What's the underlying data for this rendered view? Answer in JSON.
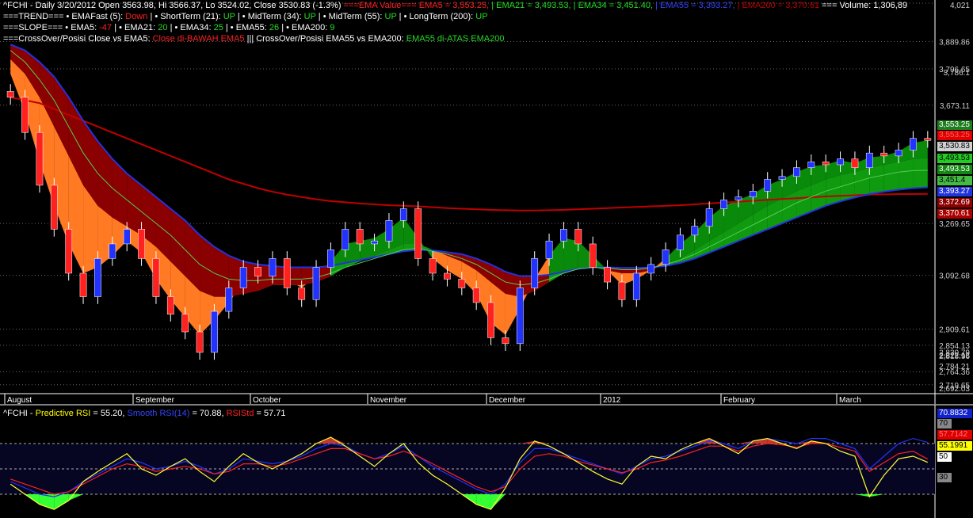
{
  "header": {
    "ticker_line": "^FCHI - Daily 3/20/2012 Open 3563.98, Hi 3566.37, Lo 3524.02, Close 3530.83 (-1.3%)",
    "ema_value_label": "===EMA Value=== EMA5 = 3,553.25,",
    "ema21": "| EMA21 = 3,493.53,",
    "ema34": "| EMA34 = 3,451.40,",
    "ema55": "| EMA55 = 3,393.27,",
    "ema200": "| EMA200 = 3,370.61",
    "volume": "=== Volume: 1,306,89",
    "trend_label": "===TREND=== • EMAFast (5):",
    "trend_fast": "Down",
    "trend_short_label": "| • ShortTerm (21):",
    "trend_short": "UP",
    "trend_mid_label": "| • MidTerm (34):",
    "trend_mid": "UP",
    "trend_mid55_label": "| • MidTerm (55):",
    "trend_mid55": "UP",
    "trend_long_label": "| • LongTerm (200):",
    "trend_long": "UP",
    "slope_label": "===SLOPE=== • EMA5:",
    "slope_ema5": "-47",
    "slope_ema21_label": "| • EMA21:",
    "slope_ema21": "20",
    "slope_ema34_label": "| • EMA34:",
    "slope_ema34": "25",
    "slope_ema55_label": "| • EMA55:",
    "slope_ema55": "26",
    "slope_ema200_label": "| • EMA200:",
    "slope_ema200": "9",
    "cross_label": "===CrossOver/Posisi Close vs EMA5:",
    "cross_value": "Close di-BAWAH EMA5",
    "cross2_label": "||| CrossOver/Posisi EMA55 vs EMA200:",
    "cross2_value": "EMA55 di-ATAS EMA200"
  },
  "rsi_header": {
    "ticker": "^FCHI -",
    "predictive_label": "Predictive RSI",
    "predictive_value": "= 55.20,",
    "smooth_label": "Smooth RSI(14)",
    "smooth_value": "= 70.88,",
    "rsistd_label": "RSIStd",
    "rsistd_value": "= 57.71"
  },
  "price_axis": [
    "4,021",
    "3,889.86",
    "3,796.65",
    "3,786.1",
    "3,673.11",
    "3,269.65",
    "3,092.68",
    "2,909.61",
    "2,854.13",
    "2,830.79",
    "2,822.13",
    "2,818.96",
    "2,784.21",
    "2,764.36",
    "2,719.65",
    "2,692.03"
  ],
  "value_tags": [
    {
      "text": "3,553.25",
      "bg": "#1e7d1e",
      "fg": "#ffffff"
    },
    {
      "text": "3,553.25",
      "bg": "#e00000",
      "fg": "#ff6060"
    },
    {
      "text": "3,530.83",
      "bg": "#d0d0d0",
      "fg": "#000000"
    },
    {
      "text": "3,493.53",
      "bg": "#22cc22",
      "fg": "#000000"
    },
    {
      "text": "3,493.53",
      "bg": "#118811",
      "fg": "#ffffff"
    },
    {
      "text": "3,451.4",
      "bg": "#44bb44",
      "fg": "#000000"
    },
    {
      "text": "3,393.27",
      "bg": "#2233dd",
      "fg": "#ffffff"
    },
    {
      "text": "3,372.69",
      "bg": "#8b0000",
      "fg": "#ffffff"
    },
    {
      "text": "3,370.61",
      "bg": "#aa0000",
      "fg": "#ffffff"
    }
  ],
  "rsi_tags": [
    {
      "text": "70.8832",
      "bg": "#1122cc",
      "fg": "#ffffff"
    },
    {
      "text": "70",
      "bg": "#888888",
      "fg": "#000000"
    },
    {
      "text": "57.7142",
      "bg": "#dd0000",
      "fg": "#ff7777"
    },
    {
      "text": "55.1991",
      "bg": "#ffff00",
      "fg": "#000000"
    },
    {
      "text": "50",
      "bg": "#ffffff",
      "fg": "#000000"
    },
    {
      "text": "30",
      "bg": "#888888",
      "fg": "#000000"
    }
  ],
  "x_axis": [
    "August",
    "September",
    "October",
    "November",
    "December",
    "2012",
    "February",
    "March"
  ],
  "chart_data": {
    "type": "line",
    "title": "^FCHI - Daily",
    "ylim": [
      2692.03,
      4021
    ],
    "x_ticks": [
      "August",
      "September",
      "October",
      "November",
      "December",
      "2012",
      "February",
      "March"
    ],
    "price_close": [
      3700,
      3580,
      3400,
      3250,
      3100,
      3020,
      3150,
      3200,
      3250,
      3150,
      3020,
      2960,
      2900,
      2830,
      2970,
      3050,
      3120,
      3090,
      3150,
      3050,
      3010,
      3120,
      3180,
      3250,
      3200,
      3210,
      3280,
      3320,
      3150,
      3100,
      3080,
      3050,
      3000,
      2880,
      2860,
      3050,
      3150,
      3210,
      3250,
      3200,
      3120,
      3070,
      3010,
      3100,
      3130,
      3180,
      3230,
      3260,
      3320,
      3350,
      3360,
      3380,
      3420,
      3430,
      3460,
      3480,
      3470,
      3490,
      3460,
      3510,
      3500,
      3520,
      3560,
      3553
    ],
    "ema5": [
      3780,
      3650,
      3480,
      3330,
      3200,
      3100,
      3120,
      3160,
      3210,
      3170,
      3080,
      3010,
      2950,
      2890,
      2940,
      3000,
      3070,
      3090,
      3120,
      3080,
      3050,
      3090,
      3140,
      3200,
      3210,
      3220,
      3250,
      3290,
      3220,
      3150,
      3110,
      3080,
      3030,
      2930,
      2890,
      2980,
      3080,
      3160,
      3220,
      3210,
      3160,
      3110,
      3060,
      3080,
      3110,
      3150,
      3200,
      3240,
      3290,
      3330,
      3350,
      3370,
      3400,
      3420,
      3445,
      3465,
      3470,
      3485,
      3475,
      3495,
      3500,
      3515,
      3545,
      3553
    ],
    "ema21": [
      3830,
      3780,
      3700,
      3600,
      3500,
      3400,
      3330,
      3290,
      3260,
      3230,
      3190,
      3140,
      3090,
      3040,
      3020,
      3020,
      3030,
      3040,
      3060,
      3060,
      3060,
      3070,
      3090,
      3120,
      3140,
      3160,
      3180,
      3200,
      3200,
      3180,
      3160,
      3140,
      3110,
      3070,
      3030,
      3020,
      3040,
      3070,
      3100,
      3120,
      3120,
      3110,
      3100,
      3100,
      3110,
      3130,
      3150,
      3180,
      3210,
      3240,
      3270,
      3300,
      3330,
      3355,
      3380,
      3400,
      3420,
      3435,
      3445,
      3460,
      3470,
      3480,
      3490,
      3493
    ],
    "ema34": [
      3860,
      3820,
      3760,
      3690,
      3600,
      3510,
      3440,
      3390,
      3350,
      3310,
      3270,
      3230,
      3180,
      3130,
      3100,
      3080,
      3075,
      3075,
      3080,
      3080,
      3080,
      3085,
      3100,
      3120,
      3135,
      3150,
      3165,
      3180,
      3185,
      3175,
      3165,
      3150,
      3130,
      3100,
      3070,
      3060,
      3065,
      3080,
      3100,
      3115,
      3120,
      3118,
      3112,
      3112,
      3118,
      3130,
      3145,
      3165,
      3190,
      3215,
      3240,
      3265,
      3290,
      3315,
      3340,
      3360,
      3380,
      3395,
      3410,
      3425,
      3435,
      3445,
      3450,
      3451
    ],
    "ema55": [
      3880,
      3860,
      3820,
      3770,
      3700,
      3620,
      3550,
      3490,
      3440,
      3400,
      3360,
      3320,
      3280,
      3230,
      3190,
      3160,
      3140,
      3130,
      3125,
      3120,
      3120,
      3120,
      3125,
      3135,
      3145,
      3155,
      3165,
      3175,
      3180,
      3178,
      3172,
      3165,
      3150,
      3130,
      3105,
      3090,
      3090,
      3095,
      3105,
      3115,
      3120,
      3120,
      3118,
      3118,
      3120,
      3125,
      3135,
      3150,
      3170,
      3190,
      3210,
      3230,
      3250,
      3270,
      3290,
      3310,
      3330,
      3345,
      3358,
      3370,
      3378,
      3385,
      3390,
      3393
    ],
    "ema200": [
      3700,
      3690,
      3680,
      3660,
      3640,
      3620,
      3600,
      3580,
      3560,
      3540,
      3520,
      3500,
      3480,
      3460,
      3440,
      3420,
      3405,
      3390,
      3378,
      3368,
      3360,
      3352,
      3346,
      3342,
      3338,
      3335,
      3332,
      3330,
      3328,
      3325,
      3322,
      3320,
      3318,
      3316,
      3315,
      3314,
      3314,
      3315,
      3316,
      3318,
      3320,
      3322,
      3324,
      3326,
      3328,
      3330,
      3332,
      3335,
      3338,
      3341,
      3344,
      3347,
      3350,
      3353,
      3356,
      3359,
      3362,
      3364,
      3366,
      3368,
      3369,
      3370,
      3370,
      3370.61
    ],
    "rsi_ylim": [
      0,
      100
    ],
    "rsi_levels": [
      30,
      50,
      70
    ],
    "predictive_rsi": [
      38,
      30,
      22,
      18,
      25,
      40,
      48,
      55,
      62,
      50,
      45,
      52,
      58,
      48,
      40,
      52,
      62,
      55,
      50,
      56,
      62,
      70,
      75,
      68,
      60,
      52,
      62,
      70,
      55,
      45,
      38,
      30,
      22,
      18,
      35,
      58,
      72,
      68,
      62,
      55,
      48,
      42,
      38,
      52,
      60,
      58,
      65,
      70,
      74,
      68,
      62,
      72,
      74,
      70,
      66,
      72,
      70,
      64,
      60,
      28,
      45,
      58,
      60,
      55.2
    ],
    "smooth_rsi": [
      40,
      35,
      30,
      28,
      32,
      40,
      46,
      52,
      58,
      55,
      50,
      52,
      56,
      52,
      46,
      50,
      58,
      56,
      54,
      56,
      60,
      66,
      70,
      68,
      62,
      58,
      62,
      68,
      60,
      52,
      46,
      40,
      34,
      30,
      38,
      55,
      66,
      66,
      62,
      58,
      54,
      50,
      46,
      52,
      58,
      60,
      64,
      68,
      72,
      70,
      66,
      72,
      74,
      72,
      70,
      74,
      74,
      70,
      66,
      50,
      60,
      70,
      74,
      70.88
    ],
    "rsistd": [
      42,
      38,
      34,
      30,
      32,
      38,
      44,
      50,
      54,
      52,
      48,
      50,
      52,
      50,
      46,
      48,
      54,
      54,
      52,
      54,
      58,
      62,
      66,
      66,
      62,
      58,
      60,
      64,
      60,
      54,
      48,
      42,
      36,
      32,
      36,
      50,
      60,
      62,
      60,
      56,
      53,
      50,
      47,
      50,
      55,
      57,
      60,
      64,
      68,
      68,
      64,
      68,
      70,
      69,
      67,
      70,
      70,
      67,
      64,
      48,
      55,
      62,
      64,
      57.71
    ]
  },
  "colors": {
    "up_candle": "#2233ff",
    "down_candle": "#ff2020",
    "ema200": "#c00000",
    "ema55": "#2233dd",
    "bull_fill": "#0a8a0a",
    "bear_fill": "#8b0000",
    "orange_fill": "#ff7a22"
  }
}
